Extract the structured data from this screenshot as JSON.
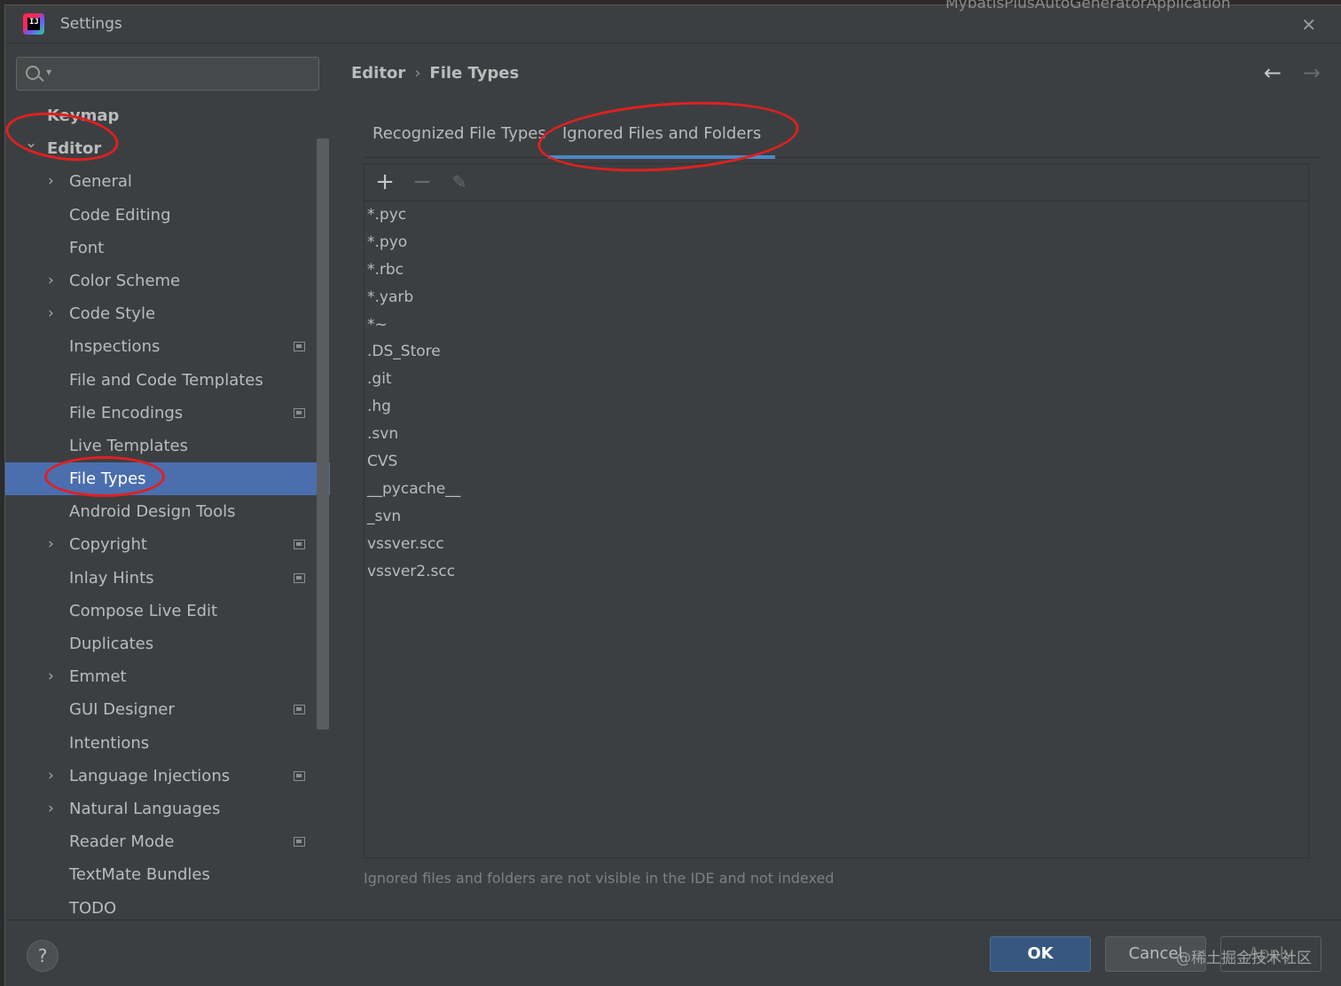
{
  "window": {
    "title": "Settings",
    "app_icon_text": "IJ",
    "top_cut_text": "MybatisPlusAutoGeneratorApplication"
  },
  "search": {
    "placeholder": "",
    "value": ""
  },
  "tree": {
    "items": [
      {
        "label": "Keymap",
        "level": 0,
        "expandable": false,
        "expanded": false,
        "selected": false,
        "badge": false
      },
      {
        "label": "Editor",
        "level": 0,
        "expandable": true,
        "expanded": true,
        "selected": false,
        "badge": false
      },
      {
        "label": "General",
        "level": 1,
        "expandable": true,
        "expanded": false,
        "selected": false,
        "badge": false
      },
      {
        "label": "Code Editing",
        "level": 1,
        "expandable": false,
        "expanded": false,
        "selected": false,
        "badge": false
      },
      {
        "label": "Font",
        "level": 1,
        "expandable": false,
        "expanded": false,
        "selected": false,
        "badge": false
      },
      {
        "label": "Color Scheme",
        "level": 1,
        "expandable": true,
        "expanded": false,
        "selected": false,
        "badge": false
      },
      {
        "label": "Code Style",
        "level": 1,
        "expandable": true,
        "expanded": false,
        "selected": false,
        "badge": false
      },
      {
        "label": "Inspections",
        "level": 1,
        "expandable": false,
        "expanded": false,
        "selected": false,
        "badge": true
      },
      {
        "label": "File and Code Templates",
        "level": 1,
        "expandable": false,
        "expanded": false,
        "selected": false,
        "badge": false
      },
      {
        "label": "File Encodings",
        "level": 1,
        "expandable": false,
        "expanded": false,
        "selected": false,
        "badge": true
      },
      {
        "label": "Live Templates",
        "level": 1,
        "expandable": false,
        "expanded": false,
        "selected": false,
        "badge": false
      },
      {
        "label": "File Types",
        "level": 1,
        "expandable": false,
        "expanded": false,
        "selected": true,
        "badge": false
      },
      {
        "label": "Android Design Tools",
        "level": 1,
        "expandable": false,
        "expanded": false,
        "selected": false,
        "badge": false
      },
      {
        "label": "Copyright",
        "level": 1,
        "expandable": true,
        "expanded": false,
        "selected": false,
        "badge": true
      },
      {
        "label": "Inlay Hints",
        "level": 1,
        "expandable": false,
        "expanded": false,
        "selected": false,
        "badge": true
      },
      {
        "label": "Compose Live Edit",
        "level": 1,
        "expandable": false,
        "expanded": false,
        "selected": false,
        "badge": false
      },
      {
        "label": "Duplicates",
        "level": 1,
        "expandable": false,
        "expanded": false,
        "selected": false,
        "badge": false
      },
      {
        "label": "Emmet",
        "level": 1,
        "expandable": true,
        "expanded": false,
        "selected": false,
        "badge": false
      },
      {
        "label": "GUI Designer",
        "level": 1,
        "expandable": false,
        "expanded": false,
        "selected": false,
        "badge": true
      },
      {
        "label": "Intentions",
        "level": 1,
        "expandable": false,
        "expanded": false,
        "selected": false,
        "badge": false
      },
      {
        "label": "Language Injections",
        "level": 1,
        "expandable": true,
        "expanded": false,
        "selected": false,
        "badge": true
      },
      {
        "label": "Natural Languages",
        "level": 1,
        "expandable": true,
        "expanded": false,
        "selected": false,
        "badge": false
      },
      {
        "label": "Reader Mode",
        "level": 1,
        "expandable": false,
        "expanded": false,
        "selected": false,
        "badge": true
      },
      {
        "label": "TextMate Bundles",
        "level": 1,
        "expandable": false,
        "expanded": false,
        "selected": false,
        "badge": false
      },
      {
        "label": "TODO",
        "level": 1,
        "expandable": false,
        "expanded": false,
        "selected": false,
        "badge": false
      }
    ]
  },
  "breadcrumb": {
    "parent": "Editor",
    "separator": "›",
    "current": "File Types"
  },
  "nav": {
    "back_icon": "arrow-left-icon",
    "forward_icon": "arrow-right-icon"
  },
  "tabs": [
    {
      "label": "Recognized File Types",
      "active": false
    },
    {
      "label": "Ignored Files and Folders",
      "active": true
    }
  ],
  "toolbar": {
    "add_icon": "plus-icon",
    "remove_icon": "minus-icon",
    "edit_icon": "pencil-icon"
  },
  "ignored_items": [
    "*.pyc",
    "*.pyo",
    "*.rbc",
    "*.yarb",
    "*~",
    ".DS_Store",
    ".git",
    ".hg",
    ".svn",
    "CVS",
    "__pycache__",
    "_svn",
    "vssver.scc",
    "vssver2.scc"
  ],
  "hint": "Ignored files and folders are not visible in the IDE and not indexed",
  "footer": {
    "help_label": "?",
    "ok_label": "OK",
    "cancel_label": "Cancel",
    "apply_label": "Apply",
    "watermark": "@稀土掘金技术社区"
  },
  "colors": {
    "background": "#3c3f41",
    "selection": "#4b6eaf",
    "tab_underline": "#4a88c7",
    "ok_button": "#365880",
    "annotation": "#e02020"
  }
}
